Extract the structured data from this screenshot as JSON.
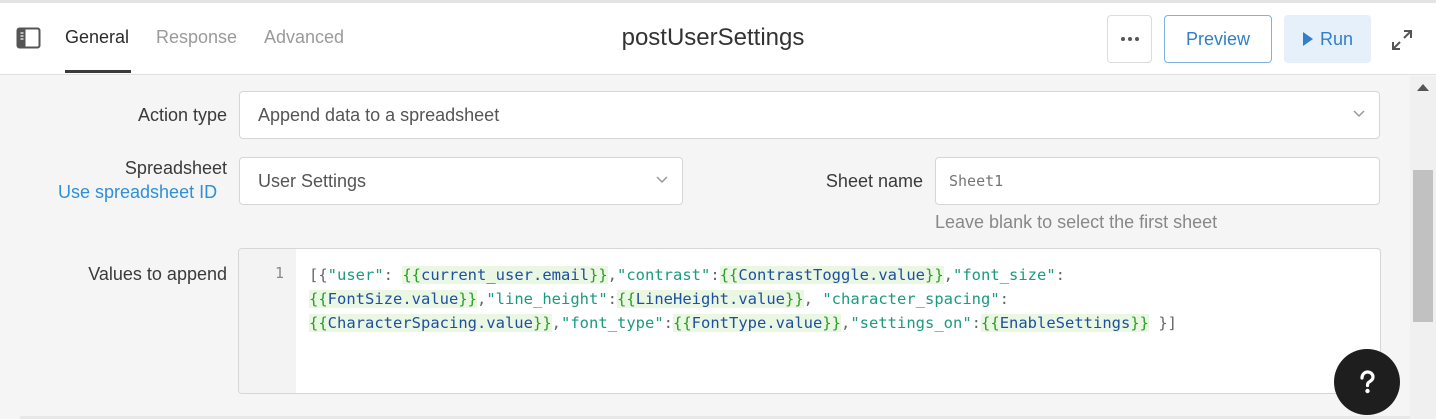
{
  "header": {
    "tabs": [
      {
        "label": "General",
        "active": true
      },
      {
        "label": "Response",
        "active": false
      },
      {
        "label": "Advanced",
        "active": false
      }
    ],
    "title": "postUserSettings",
    "preview_label": "Preview",
    "run_label": "Run",
    "more_icon": "ellipsis-icon",
    "expand_icon": "expand-icon"
  },
  "form": {
    "action_type": {
      "label": "Action type",
      "value": "Append data to a spreadsheet"
    },
    "spreadsheet": {
      "label": "Spreadsheet",
      "link": "Use spreadsheet ID",
      "value": "User Settings"
    },
    "sheet_name": {
      "label": "Sheet name",
      "placeholder": "Sheet1",
      "hint": "Leave blank to select the first sheet"
    },
    "values": {
      "label": "Values to append",
      "line_number": "1",
      "lines": [
        [
          {
            "t": "[{",
            "k": "punct"
          },
          {
            "t": "\"user\"",
            "k": "str"
          },
          {
            "t": ": ",
            "k": "punct"
          },
          {
            "t": "{{",
            "k": "tpl_open"
          },
          {
            "t": "current_user.email",
            "k": "ref"
          },
          {
            "t": "}}",
            "k": "tpl_close"
          },
          {
            "t": ",",
            "k": "punct"
          },
          {
            "t": "\"contrast\"",
            "k": "str"
          },
          {
            "t": ":",
            "k": "punct"
          },
          {
            "t": "{{",
            "k": "tpl_open"
          },
          {
            "t": "ContrastToggle.value",
            "k": "ref"
          },
          {
            "t": "}}",
            "k": "tpl_close"
          },
          {
            "t": ",",
            "k": "punct"
          },
          {
            "t": "\"font_size\"",
            "k": "str"
          },
          {
            "t": ":",
            "k": "punct"
          }
        ],
        [
          {
            "t": "{{",
            "k": "tpl_open"
          },
          {
            "t": "FontSize.value",
            "k": "ref"
          },
          {
            "t": "}}",
            "k": "tpl_close"
          },
          {
            "t": ",",
            "k": "punct"
          },
          {
            "t": "\"line_height\"",
            "k": "str"
          },
          {
            "t": ":",
            "k": "punct"
          },
          {
            "t": "{{",
            "k": "tpl_open"
          },
          {
            "t": "LineHeight.value",
            "k": "ref"
          },
          {
            "t": "}}",
            "k": "tpl_close"
          },
          {
            "t": ", ",
            "k": "punct"
          },
          {
            "t": "\"character_spacing\"",
            "k": "str"
          },
          {
            "t": ":",
            "k": "punct"
          }
        ],
        [
          {
            "t": "{{",
            "k": "tpl_open"
          },
          {
            "t": "CharacterSpacing.value",
            "k": "ref"
          },
          {
            "t": "}}",
            "k": "tpl_close"
          },
          {
            "t": ",",
            "k": "punct"
          },
          {
            "t": "\"font_type\"",
            "k": "str"
          },
          {
            "t": ":",
            "k": "punct"
          },
          {
            "t": "{{",
            "k": "tpl_open"
          },
          {
            "t": "FontType.value",
            "k": "ref"
          },
          {
            "t": "}}",
            "k": "tpl_close"
          },
          {
            "t": ",",
            "k": "punct"
          },
          {
            "t": "\"settings_on\"",
            "k": "str"
          },
          {
            "t": ":",
            "k": "punct"
          },
          {
            "t": "{{",
            "k": "tpl_open"
          },
          {
            "t": "EnableSettings",
            "k": "ref"
          },
          {
            "t": "}}",
            "k": "tpl_close"
          },
          {
            "t": " }]",
            "k": "punct"
          }
        ]
      ]
    }
  },
  "colors": {
    "accent": "#2f80c8",
    "link": "#2f8fd8",
    "template_bg": "#eaf7e2",
    "template_brace": "#2a9d2a",
    "template_ref": "#1f4fa0",
    "string": "#1a9a80"
  },
  "help_icon": "question-mark-icon"
}
